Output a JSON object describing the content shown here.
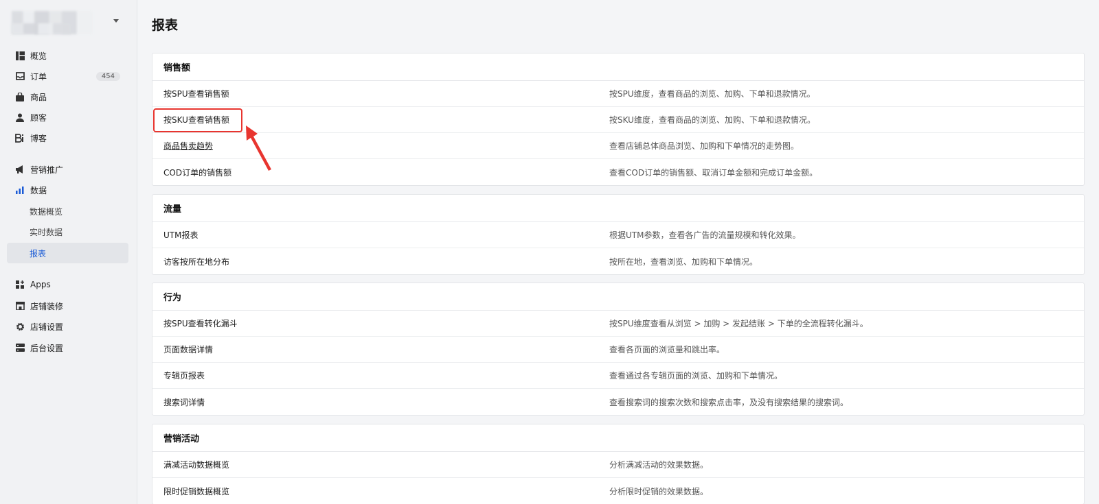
{
  "sidebar": {
    "nav": [
      {
        "label": "概览",
        "icon": "dashboard-icon"
      },
      {
        "label": "订单",
        "icon": "inbox-icon",
        "badge": "454"
      },
      {
        "label": "商品",
        "icon": "bag-icon"
      },
      {
        "label": "顾客",
        "icon": "user-icon"
      },
      {
        "label": "博客",
        "icon": "blog-icon"
      },
      {
        "label": "营销推广",
        "icon": "megaphone-icon"
      },
      {
        "label": "数据",
        "icon": "bar-chart-icon"
      },
      {
        "label": "Apps",
        "icon": "apps-icon"
      },
      {
        "label": "店铺装修",
        "icon": "storefront-icon"
      },
      {
        "label": "店铺设置",
        "icon": "gear-icon"
      },
      {
        "label": "后台设置",
        "icon": "server-icon"
      }
    ],
    "data_sub": [
      {
        "label": "数据概览"
      },
      {
        "label": "实时数据"
      },
      {
        "label": "报表"
      }
    ]
  },
  "page": {
    "title": "报表"
  },
  "sections": [
    {
      "title": "销售额",
      "rows": [
        {
          "name": "按SPU查看销售额",
          "desc": "按SPU维度，查看商品的浏览、加购、下单和退款情况。"
        },
        {
          "name": "按SKU查看销售额",
          "desc": "按SKU维度，查看商品的浏览、加购、下单和退款情况。"
        },
        {
          "name": "商品售卖趋势",
          "desc": "查看店铺总体商品浏览、加购和下单情况的走势图。"
        },
        {
          "name": "COD订单的销售额",
          "desc": "查看COD订单的销售额、取消订单金额和完成订单金额。"
        }
      ]
    },
    {
      "title": "流量",
      "rows": [
        {
          "name": "UTM报表",
          "desc": "根据UTM参数，查看各广告的流量规模和转化效果。"
        },
        {
          "name": "访客按所在地分布",
          "desc": "按所在地，查看浏览、加购和下单情况。"
        }
      ]
    },
    {
      "title": "行为",
      "rows": [
        {
          "name": "按SPU查看转化漏斗",
          "desc": "按SPU维度查看从浏览 > 加购 > 发起结账 > 下单的全流程转化漏斗。"
        },
        {
          "name": "页面数据详情",
          "desc": "查看各页面的浏览量和跳出率。"
        },
        {
          "name": "专辑页报表",
          "desc": "查看通过各专辑页面的浏览、加购和下单情况。"
        },
        {
          "name": "搜索词详情",
          "desc": "查看搜索词的搜索次数和搜索点击率，及没有搜索结果的搜索词。"
        }
      ]
    },
    {
      "title": "营销活动",
      "rows": [
        {
          "name": "满减活动数据概览",
          "desc": "分析满减活动的效果数据。"
        },
        {
          "name": "限时促销数据概览",
          "desc": "分析限时促销的效果数据。"
        }
      ]
    }
  ],
  "colors": {
    "accent": "#1a5bd6",
    "highlight": "#e8352f"
  }
}
